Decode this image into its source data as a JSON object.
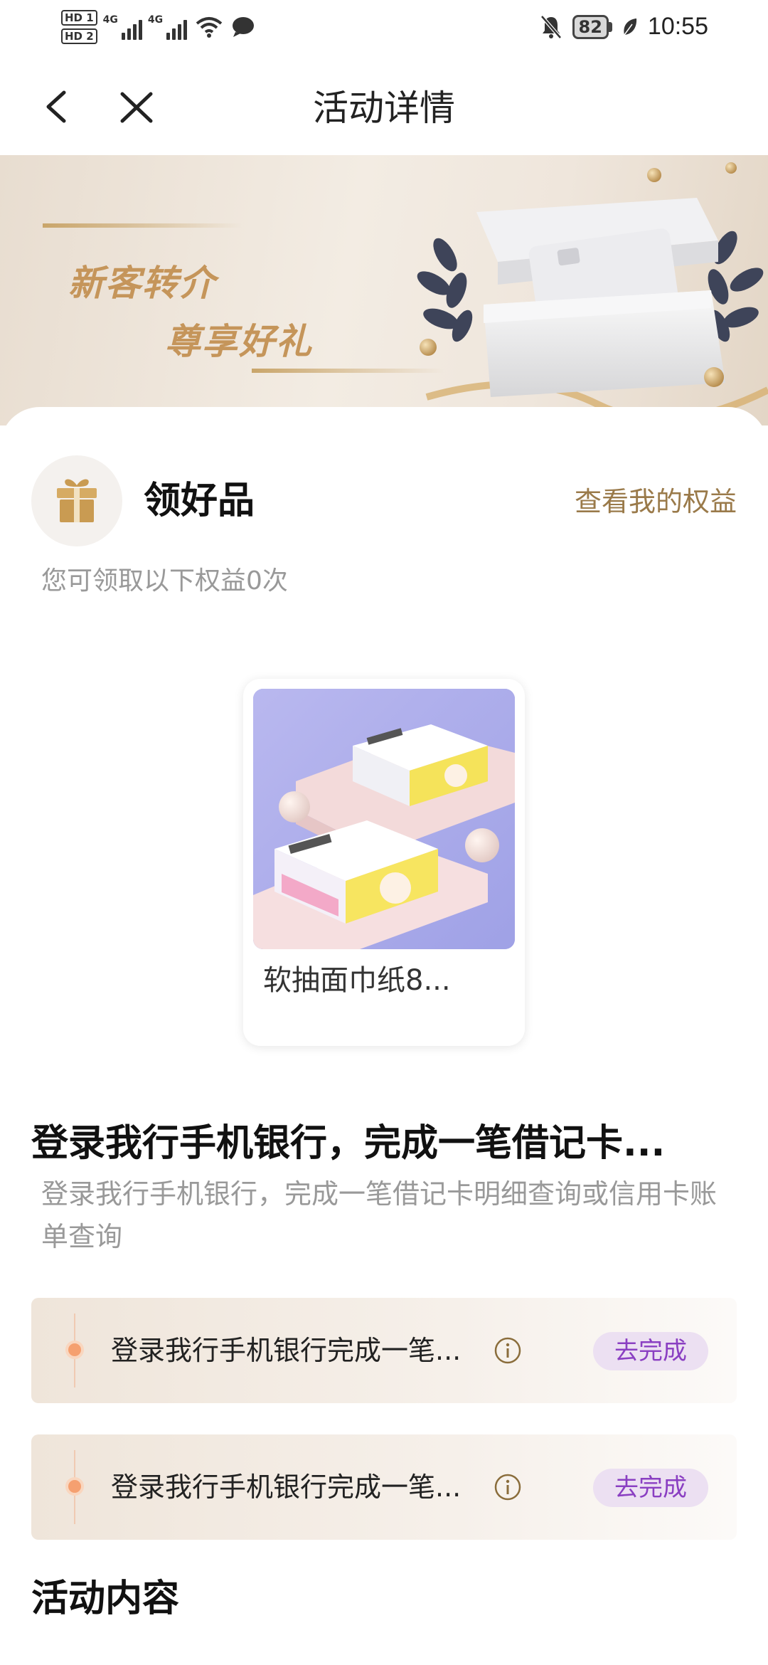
{
  "status_bar": {
    "sim1": "HD 1",
    "sim2": "HD 2",
    "net1": "4G",
    "net2": "4G",
    "battery": "82",
    "time": "10:55",
    "icons": [
      "wifi-icon",
      "chat-icon",
      "mute-bell-icon",
      "leaf-icon"
    ]
  },
  "nav": {
    "title": "活动详情",
    "icons": [
      "back-arrow-icon",
      "close-icon"
    ]
  },
  "banner": {
    "line1": "新客转介",
    "line2": "尊享好礼"
  },
  "rewards": {
    "title": "领好品",
    "link": "查看我的权益",
    "subtitle": "您可领取以下权益0次",
    "product_name": "软抽面巾纸8..."
  },
  "task": {
    "heading": "登录我行手机银行，完成一笔借记卡...",
    "description": "登录我行手机银行，完成一笔借记卡明细查询或信用卡账单查询",
    "items": [
      {
        "text": "登录我行手机银行完成一笔...",
        "button": "去完成"
      },
      {
        "text": "登录我行手机银行完成一笔...",
        "button": "去完成"
      }
    ]
  },
  "activity": {
    "title": "活动内容"
  },
  "colors": {
    "accent_gold": "#c5955a",
    "link_brown": "#9a7a4a",
    "button_purple": "#8a3fc2",
    "button_bg": "#ece0f2",
    "dot_orange": "#f5a070"
  }
}
